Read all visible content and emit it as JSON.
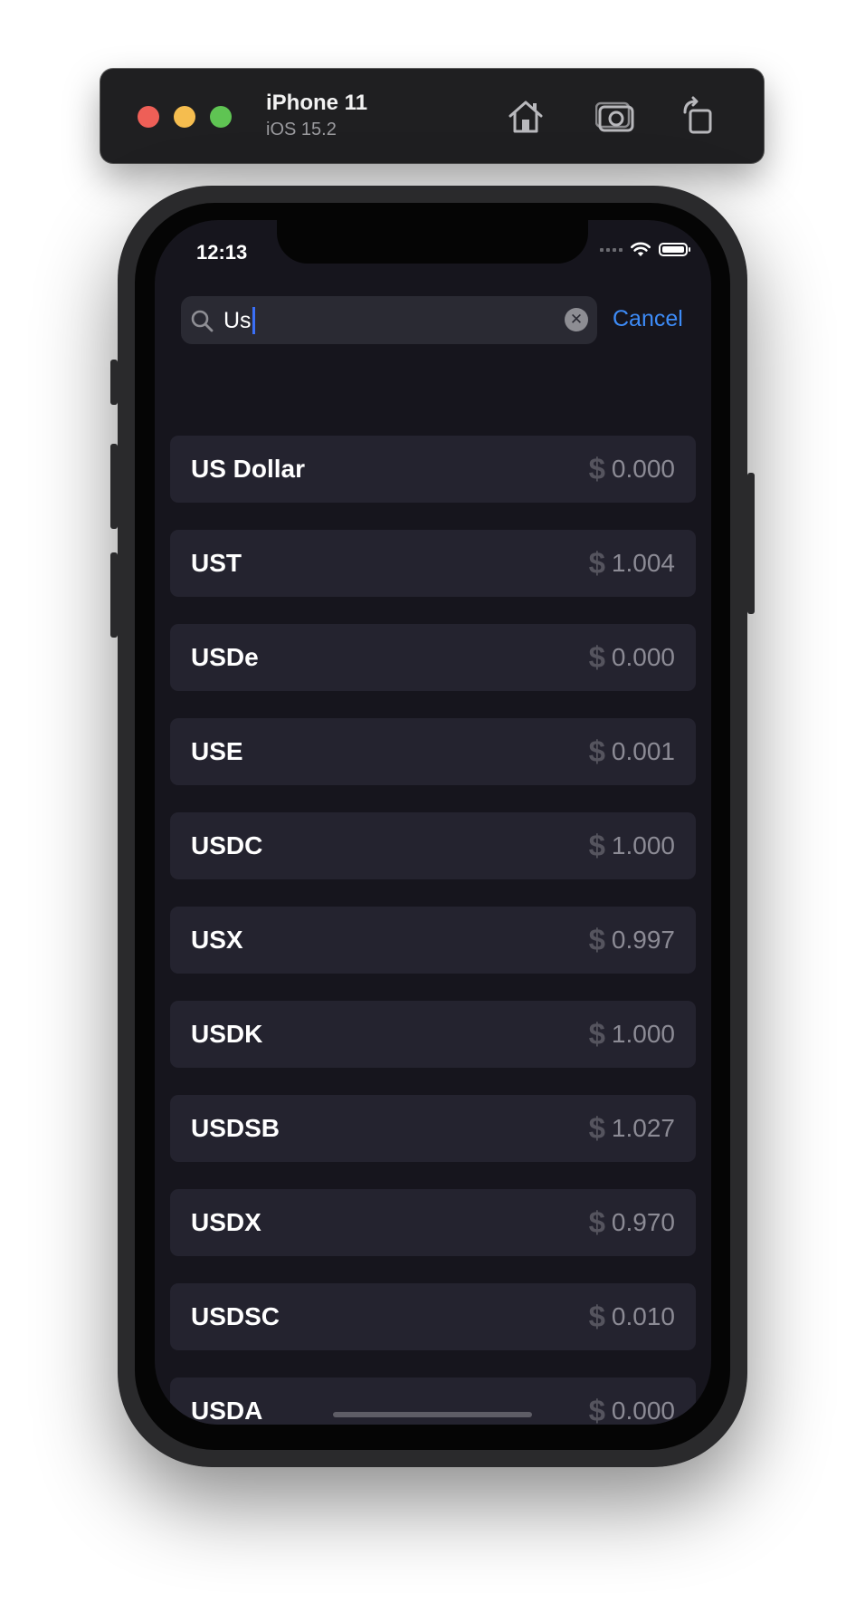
{
  "simulator": {
    "device_name": "iPhone 11",
    "os_version": "iOS 15.2"
  },
  "status_bar": {
    "time": "12:13"
  },
  "search": {
    "query": "Us",
    "cancel_label": "Cancel"
  },
  "currencies": [
    {
      "name": "US Dollar",
      "symbol": "$",
      "price": "0.000"
    },
    {
      "name": "UST",
      "symbol": "$",
      "price": "1.004"
    },
    {
      "name": "USDe",
      "symbol": "$",
      "price": "0.000"
    },
    {
      "name": "USE",
      "symbol": "$",
      "price": "0.001"
    },
    {
      "name": "USDC",
      "symbol": "$",
      "price": "1.000"
    },
    {
      "name": "USX",
      "symbol": "$",
      "price": "0.997"
    },
    {
      "name": "USDK",
      "symbol": "$",
      "price": "1.000"
    },
    {
      "name": "USDSB",
      "symbol": "$",
      "price": "1.027"
    },
    {
      "name": "USDX",
      "symbol": "$",
      "price": "0.970"
    },
    {
      "name": "USDSC",
      "symbol": "$",
      "price": "0.010"
    },
    {
      "name": "USDA",
      "symbol": "$",
      "price": "0.000"
    }
  ],
  "colors": {
    "background": "#16151d",
    "row_background": "#24232f",
    "accent": "#3d8bf7"
  }
}
